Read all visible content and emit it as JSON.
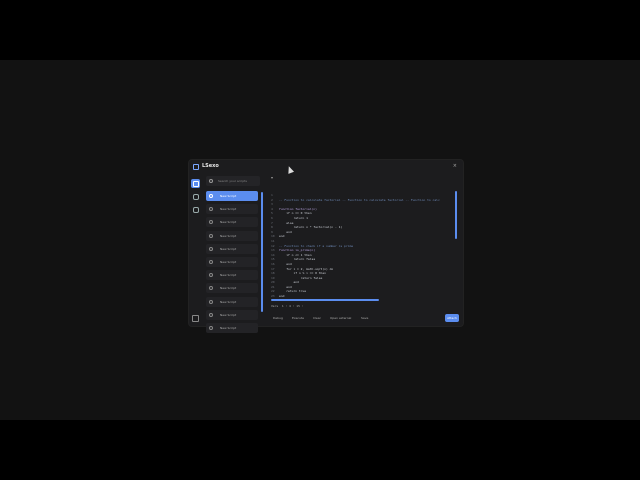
{
  "app": {
    "title": "LSexo",
    "close_glyph": "×"
  },
  "rail": {
    "icons": [
      "scripts-icon",
      "home-icon",
      "settings-icon"
    ],
    "footer_icon": "layout-icon"
  },
  "sidebar": {
    "search_placeholder": "Search your scripts",
    "items": [
      "New Script",
      "New Script",
      "New Script",
      "New Script",
      "New Script",
      "New Script",
      "New Script",
      "New Script",
      "New Script",
      "New Script",
      "New Script"
    ]
  },
  "editor": {
    "tab_glyph": "▾",
    "lines": [
      {
        "n": "1",
        "t": "",
        "cls": ""
      },
      {
        "n": "2",
        "t": "-- Function to calculate factorial -- Function to calculate factorial -- Function to calc",
        "cls": "c"
      },
      {
        "n": "3",
        "t": "",
        "cls": ""
      },
      {
        "n": "4",
        "t": "function factorial(n)",
        "cls": "kw"
      },
      {
        "n": "5",
        "t": "    if n == 0 then",
        "cls": ""
      },
      {
        "n": "6",
        "t": "        return 1",
        "cls": ""
      },
      {
        "n": "7",
        "t": "    else",
        "cls": ""
      },
      {
        "n": "8",
        "t": "        return n * factorial(n - 1)",
        "cls": ""
      },
      {
        "n": "9",
        "t": "    end",
        "cls": ""
      },
      {
        "n": "10",
        "t": "end",
        "cls": ""
      },
      {
        "n": "11",
        "t": "",
        "cls": ""
      },
      {
        "n": "12",
        "t": "-- Function to check if a number is prime",
        "cls": "c"
      },
      {
        "n": "13",
        "t": "function is_prime(n)",
        "cls": "kw"
      },
      {
        "n": "14",
        "t": "    if n <= 1 then",
        "cls": ""
      },
      {
        "n": "15",
        "t": "        return false",
        "cls": ""
      },
      {
        "n": "16",
        "t": "    end",
        "cls": ""
      },
      {
        "n": "17",
        "t": "    for i = 2, math.sqrt(n) do",
        "cls": ""
      },
      {
        "n": "18",
        "t": "        if n % i == 0 then",
        "cls": ""
      },
      {
        "n": "19",
        "t": "            return false",
        "cls": ""
      },
      {
        "n": "20",
        "t": "        end",
        "cls": ""
      },
      {
        "n": "21",
        "t": "    end",
        "cls": ""
      },
      {
        "n": "22",
        "t": "    return true",
        "cls": ""
      },
      {
        "n": "23",
        "t": "end",
        "cls": ""
      }
    ]
  },
  "status": {
    "text": "Vers  1 : 4 : 15 :"
  },
  "bottombar": {
    "buttons": [
      "Debug",
      "Execute",
      "Clear",
      "Open external",
      "Save"
    ],
    "primary": "Attach"
  },
  "colors": {
    "accent": "#5b8def",
    "background": "#121212",
    "window": "#1c1c1e"
  }
}
